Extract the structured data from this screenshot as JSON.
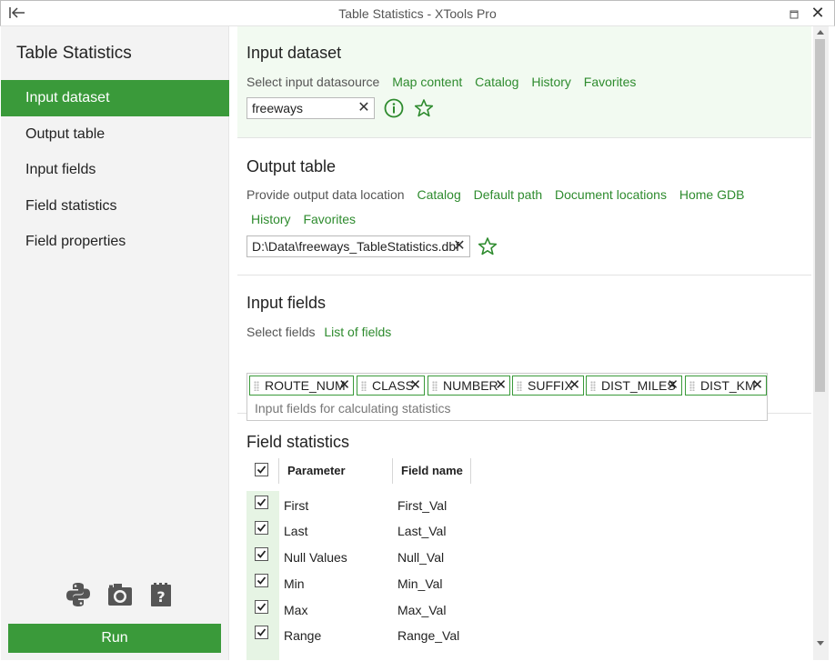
{
  "window": {
    "title": "Table Statistics - XTools Pro"
  },
  "sidebar": {
    "title": "Table Statistics",
    "items": [
      {
        "label": "Input dataset",
        "active": true
      },
      {
        "label": "Output table"
      },
      {
        "label": "Input fields"
      },
      {
        "label": "Field statistics"
      },
      {
        "label": "Field properties"
      }
    ],
    "icons": [
      "python-icon",
      "camera-icon",
      "help-document-icon"
    ],
    "run_label": "Run"
  },
  "input_dataset": {
    "title": "Input dataset",
    "prompt": "Select input datasource",
    "links": [
      "Map content",
      "Catalog",
      "History",
      "Favorites"
    ],
    "value": "freeways"
  },
  "output_table": {
    "title": "Output table",
    "prompt": "Provide output data location",
    "links_row1": [
      "Catalog",
      "Default path",
      "Document locations",
      "Home GDB"
    ],
    "links_row2": [
      "History",
      "Favorites"
    ],
    "value": "D:\\Data\\freeways_TableStatistics.dbf"
  },
  "input_fields": {
    "title": "Input fields",
    "prompt": "Select fields",
    "link": "List of fields",
    "chips": [
      "ROUTE_NUM",
      "CLASS",
      "NUMBER",
      "SUFFIX",
      "DIST_MILES",
      "DIST_KM"
    ],
    "placeholder": "Input fields for calculating statistics"
  },
  "field_statistics": {
    "title": "Field statistics",
    "columns": [
      "Parameter",
      "Field name"
    ],
    "rows": [
      {
        "parameter": "First",
        "field": "First_Val",
        "checked": true
      },
      {
        "parameter": "Last",
        "field": "Last_Val",
        "checked": true
      },
      {
        "parameter": "Null Values",
        "field": "Null_Val",
        "checked": true
      },
      {
        "parameter": "Min",
        "field": "Min_Val",
        "checked": true
      },
      {
        "parameter": "Max",
        "field": "Max_Val",
        "checked": true
      },
      {
        "parameter": "Range",
        "field": "Range_Val",
        "checked": true
      }
    ]
  },
  "colors": {
    "accent": "#3a9a3a",
    "link": "#2e8b2e",
    "active_section_bg": "#f2faf1"
  }
}
